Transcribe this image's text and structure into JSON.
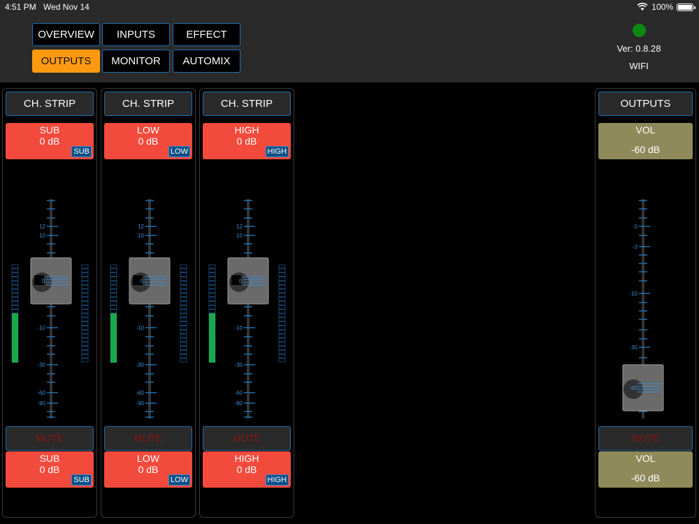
{
  "status": {
    "time": "4:51 PM",
    "date": "Wed Nov 14",
    "battery": "100%"
  },
  "nav": [
    "OVERVIEW",
    "INPUTS",
    "EFFECT",
    "OUTPUTS",
    "MONITOR",
    "AUTOMIX"
  ],
  "nav_active": "OUTPUTS",
  "device": {
    "version": "Ver: 0.8.28",
    "connection": "WIFI",
    "status_color": "#0a8a12"
  },
  "channels": [
    {
      "button": "CH. STRIP",
      "name": "SUB",
      "gain": "0 dB",
      "tag": "SUB",
      "mute": "MUTE",
      "meter_level": 0.72
    },
    {
      "button": "CH. STRIP",
      "name": "LOW",
      "gain": "0 dB",
      "tag": "LOW",
      "mute": "MUTE",
      "meter_level": 0.72
    },
    {
      "button": "CH. STRIP",
      "name": "HIGH",
      "gain": "0 dB",
      "tag": "HIGH",
      "mute": "MUTE",
      "meter_level": 0.72
    }
  ],
  "channel_scale": [
    "12",
    "10",
    "0",
    "-10",
    "-30",
    "-60",
    "-90"
  ],
  "channel_fader_value": "0",
  "output": {
    "button": "OUTPUTS",
    "label": "VOL",
    "value": "-60 dB",
    "mute": "MUTE",
    "scale": [
      "0",
      "-3",
      "-10",
      "-30",
      "-60"
    ],
    "fader_value": "-60"
  },
  "colors": {
    "accent": "#ff9a10",
    "eq": "#f24a3c",
    "vol": "#8e8a5a",
    "border": "#1f6fb0",
    "meter": "#1aa84a"
  }
}
